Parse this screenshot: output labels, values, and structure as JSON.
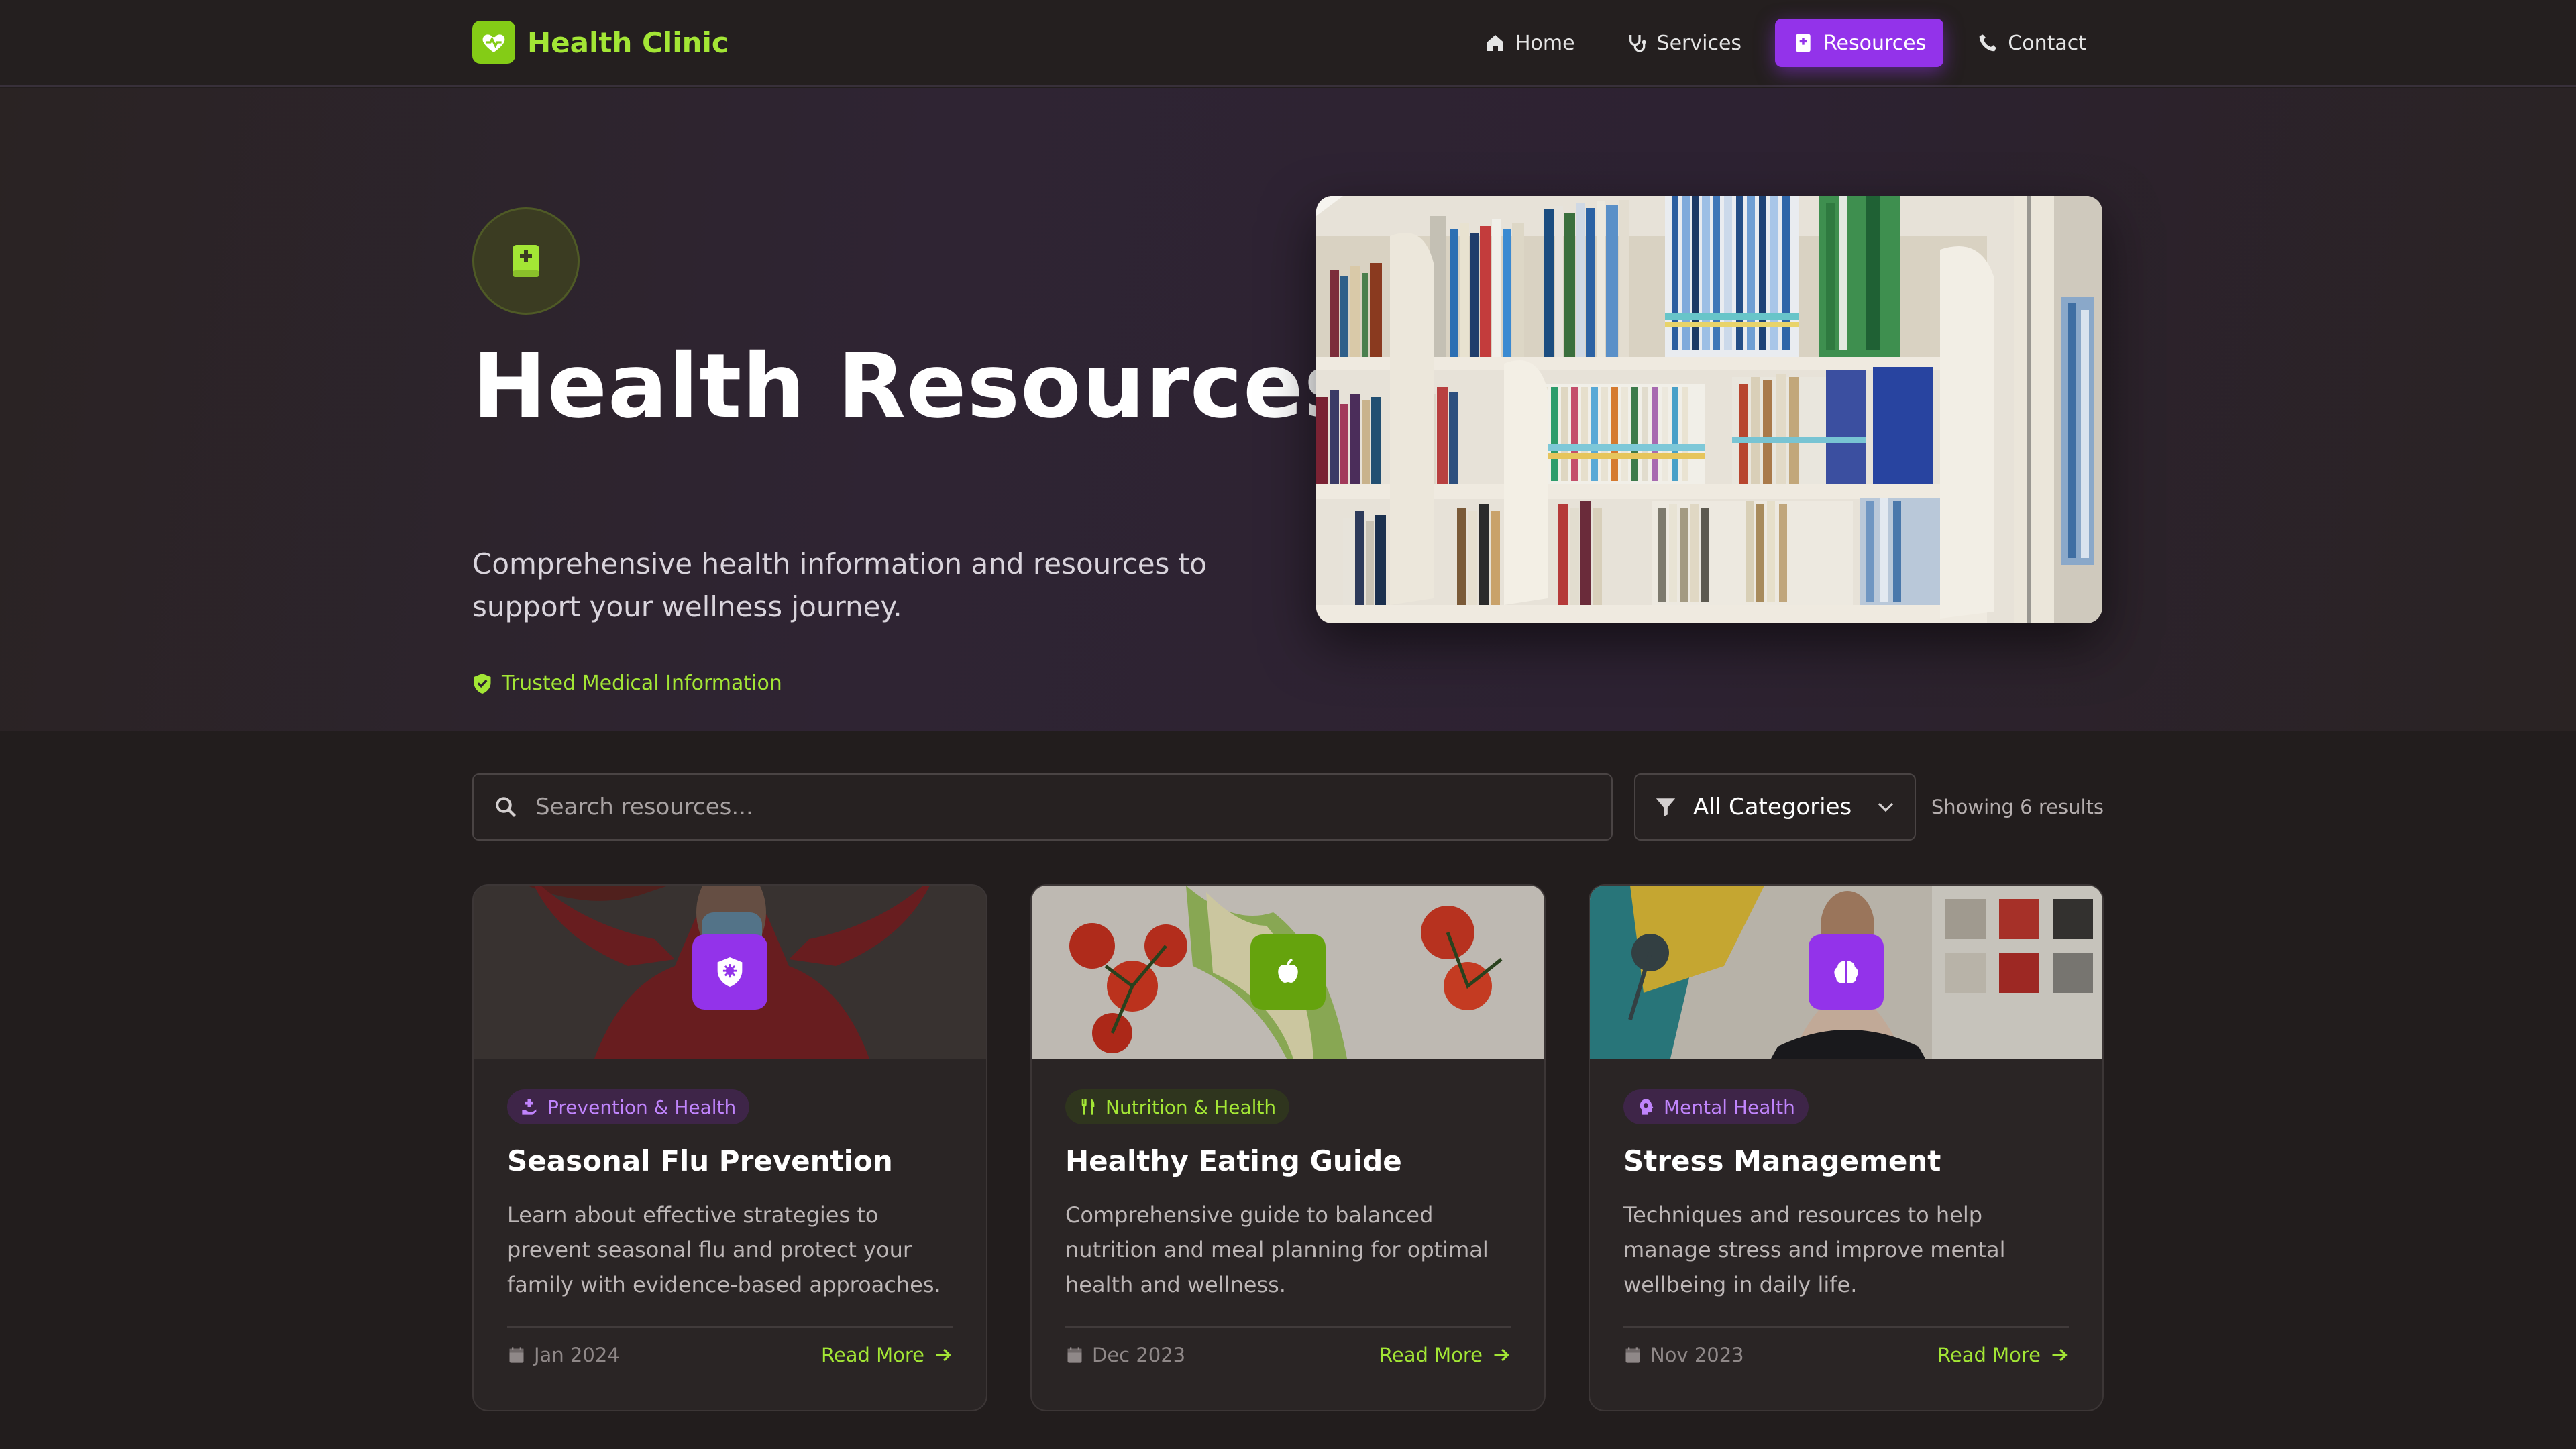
{
  "header": {
    "logo_text": "Health Clinic",
    "nav": [
      {
        "label": "Home",
        "icon": "home-icon",
        "active": false
      },
      {
        "label": "Services",
        "icon": "stethoscope-icon",
        "active": false
      },
      {
        "label": "Resources",
        "icon": "book-medical-icon",
        "active": true
      },
      {
        "label": "Contact",
        "icon": "phone-icon",
        "active": false
      }
    ]
  },
  "hero": {
    "title": "Health Resources",
    "subtitle": "Comprehensive health information and resources to support your wellness journey.",
    "trust_label": "Trusted Medical Information",
    "image_icon": "library-bookshelf-photo"
  },
  "toolbar": {
    "search_placeholder": "Search resources...",
    "category_selected": "All Categories",
    "results_text": "Showing 6 results"
  },
  "cards": [
    {
      "category": "Prevention & Health",
      "title": "Seasonal Flu Prevention",
      "description": "Learn about effective strategies to prevent seasonal flu and protect your family with evidence-based approaches.",
      "date": "Jan 2024",
      "link": "Read More",
      "icon": "virus-shield-icon",
      "icon_color": "#9333ea"
    },
    {
      "category": "Nutrition & Health",
      "title": "Healthy Eating Guide",
      "description": "Comprehensive guide to balanced nutrition and meal planning for optimal health and wellness.",
      "date": "Dec 2023",
      "link": "Read More",
      "icon": "apple-icon",
      "icon_color": "#65a30d"
    },
    {
      "category": "Mental Health",
      "title": "Stress Management",
      "description": "Techniques and resources to help manage stress and improve mental wellbeing in daily life.",
      "date": "Nov 2023",
      "link": "Read More",
      "icon": "brain-icon",
      "icon_color": "#9333ea"
    }
  ],
  "colors": {
    "accent_green": "#a3e635",
    "accent_purple": "#9333ea",
    "background": "#221d1d"
  }
}
